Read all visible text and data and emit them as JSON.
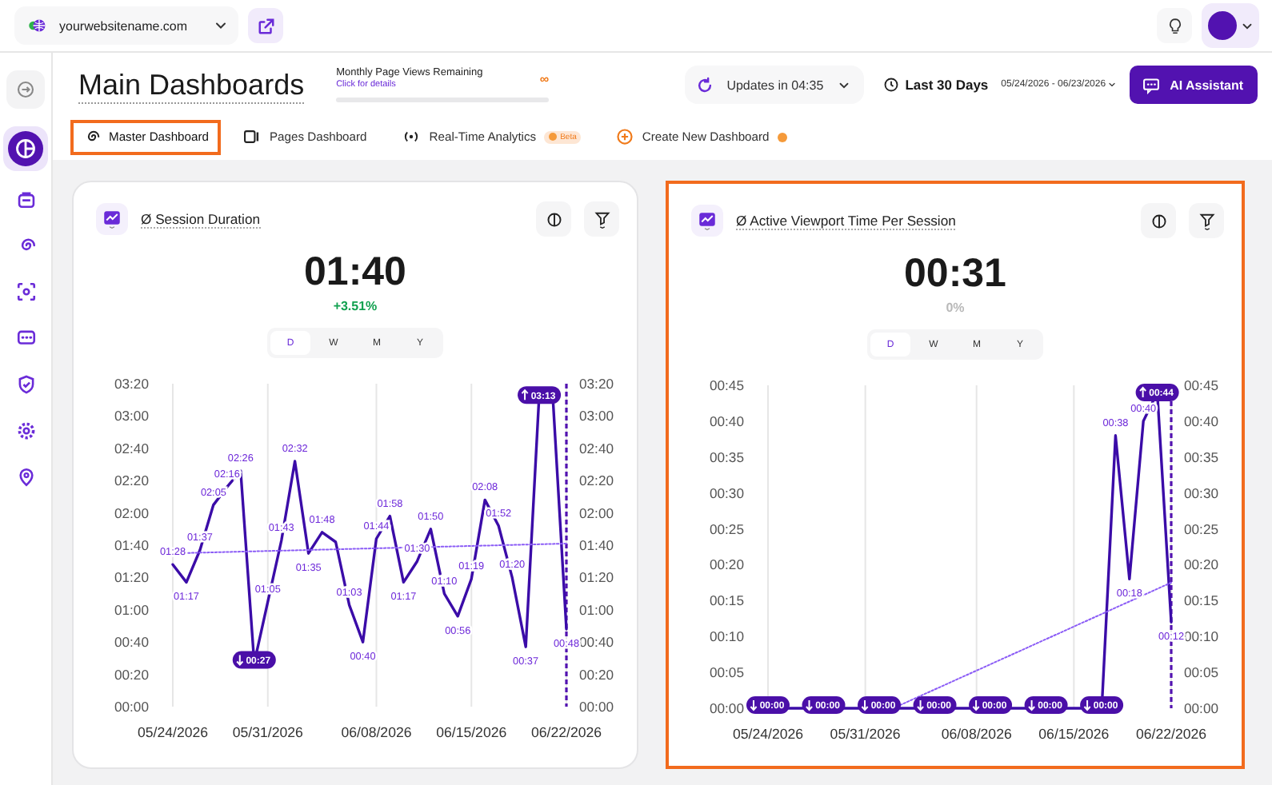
{
  "top_bar": {
    "site": "yourwebsitename.com"
  },
  "sidebar": {
    "items": [
      {
        "selected": true
      },
      {
        "selected": false
      },
      {
        "selected": false
      },
      {
        "selected": false
      },
      {
        "selected": false
      },
      {
        "selected": false
      },
      {
        "selected": false
      },
      {
        "selected": false
      }
    ]
  },
  "header": {
    "title": "Main Dashboards",
    "quota": {
      "label": "Monthly Page Views Remaining",
      "link": "Click for details",
      "value": "∞"
    },
    "updates": "Updates in 04:35",
    "range": {
      "label": "Last 30 Days",
      "dates": "05/24/2026 - 06/23/2026"
    },
    "ai_button": "AI Assistant"
  },
  "tabs": [
    {
      "label": "Master Dashboard",
      "kind": "dashboard",
      "selected": true,
      "highlighted": true,
      "new_dot": false
    },
    {
      "label": "Pages Dashboard",
      "kind": "pages",
      "selected": false,
      "highlighted": false,
      "new_dot": false
    },
    {
      "label": "Real-Time Analytics",
      "kind": "realtime",
      "badge": "Beta",
      "selected": false,
      "highlighted": false,
      "new_dot": false
    },
    {
      "label": "Create New Dashboard",
      "kind": "create",
      "selected": false,
      "highlighted": false,
      "new_dot": true
    }
  ],
  "cards": [
    {
      "title": "Ø Session Duration",
      "value": "01:40",
      "change": {
        "text": "+3.51%",
        "color": "#12a150"
      },
      "highlighted": false,
      "periods": [
        {
          "label": "D",
          "selected": true
        },
        {
          "label": "W",
          "selected": false
        },
        {
          "label": "M",
          "selected": false
        },
        {
          "label": "Y",
          "selected": false
        }
      ],
      "chart_data": {
        "type": "line",
        "grid": true,
        "categories": [
          "05/24/2026",
          null,
          null,
          null,
          null,
          null,
          null,
          "05/31/2026",
          null,
          null,
          null,
          null,
          null,
          null,
          null,
          "06/08/2026",
          null,
          null,
          null,
          null,
          null,
          null,
          "06/15/2026",
          null,
          null,
          null,
          null,
          null,
          null,
          "06/22/2026"
        ],
        "ylim": [
          0,
          200
        ],
        "yticks": [
          {
            "value": 0,
            "label": "00:00"
          },
          {
            "value": 20,
            "label": "00:20"
          },
          {
            "value": 40,
            "label": "00:40"
          },
          {
            "value": 60,
            "label": "01:00"
          },
          {
            "value": 80,
            "label": "01:20"
          },
          {
            "value": 100,
            "label": "01:40"
          },
          {
            "value": 120,
            "label": "02:00"
          },
          {
            "value": 140,
            "label": "02:20"
          },
          {
            "value": 160,
            "label": "02:40"
          },
          {
            "value": 180,
            "label": "03:00"
          },
          {
            "value": 200,
            "label": "03:20"
          }
        ],
        "series": [
          {
            "color": "#3b0ca8",
            "line_style": "solid",
            "values": [
              88,
              77,
              97,
              125,
              136,
              146,
              27,
              65,
              103,
              152,
              95,
              108,
              102,
              63,
              40,
              104,
              118,
              77,
              90,
              110,
              70,
              56,
              79,
              128,
              112,
              80,
              37,
              193,
              192,
              48
            ]
          },
          {
            "color": "#8b5cf6",
            "line_style": "dotted",
            "values": [
              95,
              null,
              null,
              null,
              null,
              null,
              null,
              null,
              null,
              null,
              null,
              null,
              null,
              null,
              null,
              null,
              null,
              null,
              null,
              null,
              null,
              null,
              null,
              null,
              null,
              null,
              null,
              null,
              null,
              101
            ]
          }
        ],
        "value_labels": [
          "01:28",
          "01:17",
          "01:37",
          "02:05",
          "02:16",
          "02:26",
          "00:27",
          "01:05",
          "01:43",
          "02:32",
          "01:35",
          "01:48",
          null,
          "01:03",
          "00:40",
          "01:44",
          "01:58",
          "01:17",
          "01:30",
          "01:50",
          "01:10",
          "00:56",
          "01:19",
          "02:08",
          "01:52",
          "01:20",
          "00:37",
          "03:13",
          null,
          "00:48"
        ]
      }
    },
    {
      "title": "Ø Active Viewport Time Per Session",
      "value": "00:31",
      "change": {
        "text": "0%",
        "color": "#b9b9b9"
      },
      "highlighted": true,
      "periods": [
        {
          "label": "D",
          "selected": true
        },
        {
          "label": "W",
          "selected": false
        },
        {
          "label": "M",
          "selected": false
        },
        {
          "label": "Y",
          "selected": false
        }
      ],
      "chart_data": {
        "type": "line",
        "grid": true,
        "categories": [
          "05/24/2026",
          null,
          null,
          null,
          null,
          null,
          null,
          "05/31/2026",
          null,
          null,
          null,
          null,
          null,
          null,
          null,
          "06/08/2026",
          null,
          null,
          null,
          null,
          null,
          null,
          "06/15/2026",
          null,
          null,
          null,
          null,
          null,
          null,
          "06/22/2026"
        ],
        "ylim": [
          0,
          45
        ],
        "yticks": [
          {
            "value": 0,
            "label": "00:00"
          },
          {
            "value": 5,
            "label": "00:05"
          },
          {
            "value": 10,
            "label": "00:10"
          },
          {
            "value": 15,
            "label": "00:15"
          },
          {
            "value": 20,
            "label": "00:20"
          },
          {
            "value": 25,
            "label": "00:25"
          },
          {
            "value": 30,
            "label": "00:30"
          },
          {
            "value": 35,
            "label": "00:35"
          },
          {
            "value": 40,
            "label": "00:40"
          },
          {
            "value": 45,
            "label": "00:45"
          }
        ],
        "series": [
          {
            "color": "#3b0ca8",
            "line_style": "solid",
            "values": [
              0,
              0,
              0,
              0,
              0,
              0,
              0,
              0,
              0,
              0,
              0,
              0,
              0,
              0,
              0,
              0,
              0,
              0,
              0,
              0,
              0,
              0,
              0,
              0,
              0,
              38,
              18,
              40,
              44,
              12
            ]
          },
          {
            "color": "#8b5cf6",
            "line_style": "dotted",
            "values": [
              null,
              null,
              null,
              null,
              null,
              null,
              null,
              null,
              null,
              0,
              null,
              null,
              null,
              null,
              null,
              null,
              null,
              null,
              null,
              null,
              null,
              null,
              null,
              null,
              null,
              null,
              null,
              null,
              null,
              17.5
            ]
          }
        ],
        "value_labels": [
          "00:00",
          null,
          null,
          null,
          "00:00",
          null,
          null,
          null,
          "00:00",
          null,
          null,
          null,
          "00:00",
          null,
          null,
          null,
          "00:00",
          null,
          null,
          null,
          "00:00",
          null,
          null,
          null,
          "00:00",
          "00:38",
          "00:18",
          "00:40",
          "00:44",
          "00:12"
        ]
      }
    }
  ]
}
